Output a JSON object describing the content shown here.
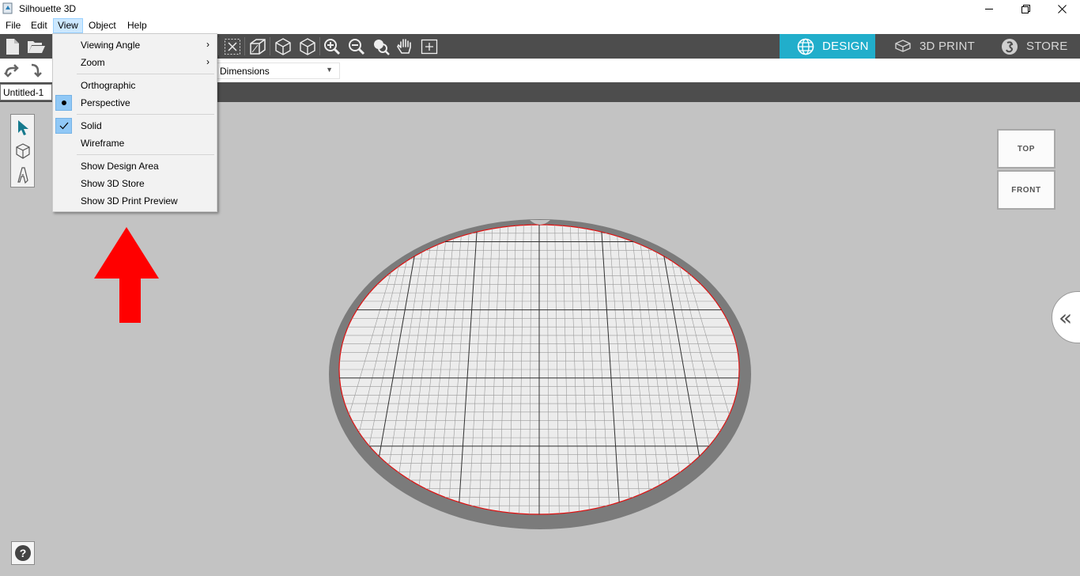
{
  "window": {
    "title": "Silhouette 3D",
    "minimize_icon": "minimize-icon",
    "restore_icon": "restore-icon",
    "close_icon": "close-icon"
  },
  "menubar": {
    "items": [
      "File",
      "Edit",
      "View",
      "Object",
      "Help"
    ],
    "active": "View"
  },
  "toolbar": {
    "icons": [
      "new-document-icon",
      "open-folder-icon",
      "fit-to-area-icon",
      "perspective-box-icon",
      "solid-cube-icon",
      "wireframe-cube-icon",
      "zoom-in-icon",
      "zoom-out-icon",
      "zoom-selection-icon",
      "pan-hand-icon",
      "zoom-fit-icon"
    ],
    "modes": [
      {
        "label": "DESIGN",
        "icon": "globe-icon",
        "active": true
      },
      {
        "label": "3D PRINT",
        "icon": "print-tray-icon",
        "active": false
      },
      {
        "label": "STORE",
        "icon": "store-logo-icon",
        "active": false
      }
    ],
    "accent_color": "#21aecb"
  },
  "options": {
    "dimensions_select": "Dimensions"
  },
  "document": {
    "tab_label": "Untitled-1"
  },
  "view_menu": {
    "items": [
      {
        "label": "Viewing Angle",
        "submenu": true
      },
      {
        "label": "Zoom",
        "submenu": true
      },
      {
        "label": "Orthographic"
      },
      {
        "label": "Perspective",
        "checked": "radio"
      },
      {
        "label": "Solid",
        "checked": "check"
      },
      {
        "label": "Wireframe"
      },
      {
        "label": "Show Design Area"
      },
      {
        "label": "Show 3D Store"
      },
      {
        "label": "Show 3D Print Preview"
      }
    ],
    "submenu_arrow": "›"
  },
  "left_tools": [
    "select-arrow-icon",
    "cube-shape-icon",
    "text-tool-icon"
  ],
  "viewcube": {
    "top_label": "TOP",
    "front_label": "FRONT"
  },
  "right_panel": {
    "collapse_glyph": "«"
  },
  "help": {
    "glyph": "?"
  },
  "annotation": {
    "arrow_color": "#ff0000"
  }
}
